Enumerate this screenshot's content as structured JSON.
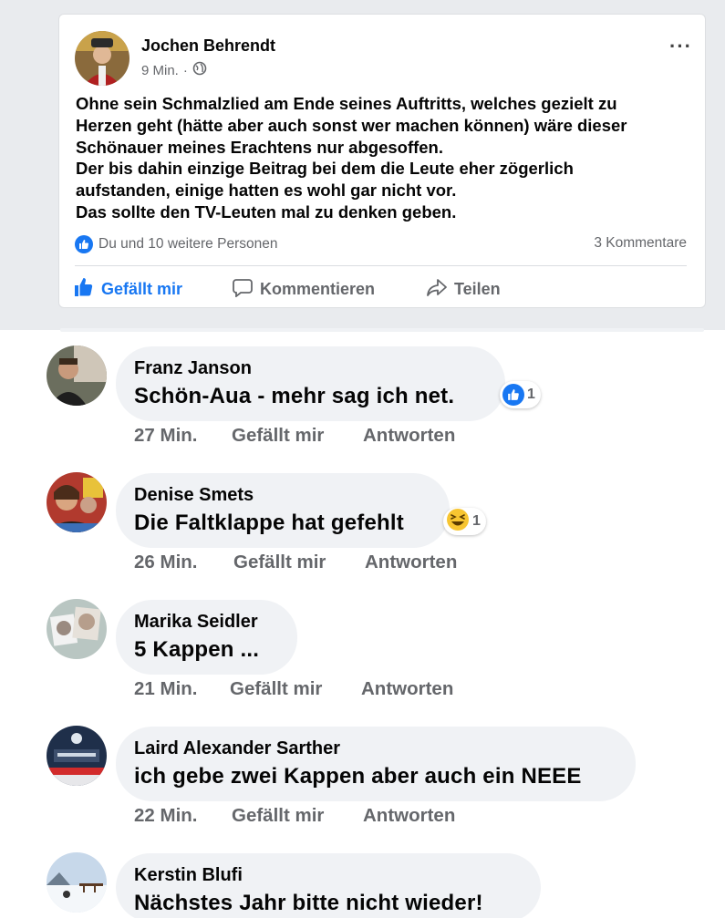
{
  "post": {
    "author": "Jochen Behrendt",
    "time": "9 Min.",
    "separator": "·",
    "menu": "···",
    "text_lines": [
      "Ohne sein Schmalzlied am Ende seines Auftritts, welches gezielt zu",
      "Herzen geht (hätte aber auch sonst wer machen können) wäre dieser",
      "Schönauer meines Erachtens nur abgesoffen.",
      "Der bis dahin einzige Beitrag bei dem die Leute eher zögerlich",
      "aufstanden, einige hatten es wohl gar nicht vor.",
      "Das sollte den TV-Leuten mal zu denken geben."
    ],
    "reactions": "Du und 10 weitere Personen",
    "comment_count": "3 Kommentare",
    "actions": {
      "like": "Gefällt mir",
      "comment": "Kommentieren",
      "share": "Teilen"
    }
  },
  "comments": [
    {
      "name": "Franz Janson",
      "text": "Schön-Aua - mehr sag ich net.",
      "reaction_icon": "like-icon",
      "reaction_count": "1",
      "time": "27 Min.",
      "like": "Gefällt mir",
      "reply": "Antworten"
    },
    {
      "name": "Denise Smets",
      "text": "Die Faltklappe hat gefehlt",
      "reaction_icon": "haha-icon",
      "reaction_count": "1",
      "time": "26 Min.",
      "like": "Gefällt mir",
      "reply": "Antworten"
    },
    {
      "name": "Marika Seidler",
      "text": "5 Kappen ...",
      "time": "21 Min.",
      "like": "Gefällt mir",
      "reply": "Antworten"
    },
    {
      "name": "Laird Alexander Sarther",
      "text": "ich gebe zwei Kappen aber auch ein NEEE",
      "time": "22 Min.",
      "like": "Gefällt mir",
      "reply": "Antworten"
    },
    {
      "name": "Kerstin Blufi",
      "text": "Nächstes Jahr bitte nicht wieder!"
    }
  ],
  "colors": {
    "accent": "#1877f2",
    "muted": "#65676b",
    "bubble": "#f0f2f5",
    "background": "#e9ebee"
  }
}
